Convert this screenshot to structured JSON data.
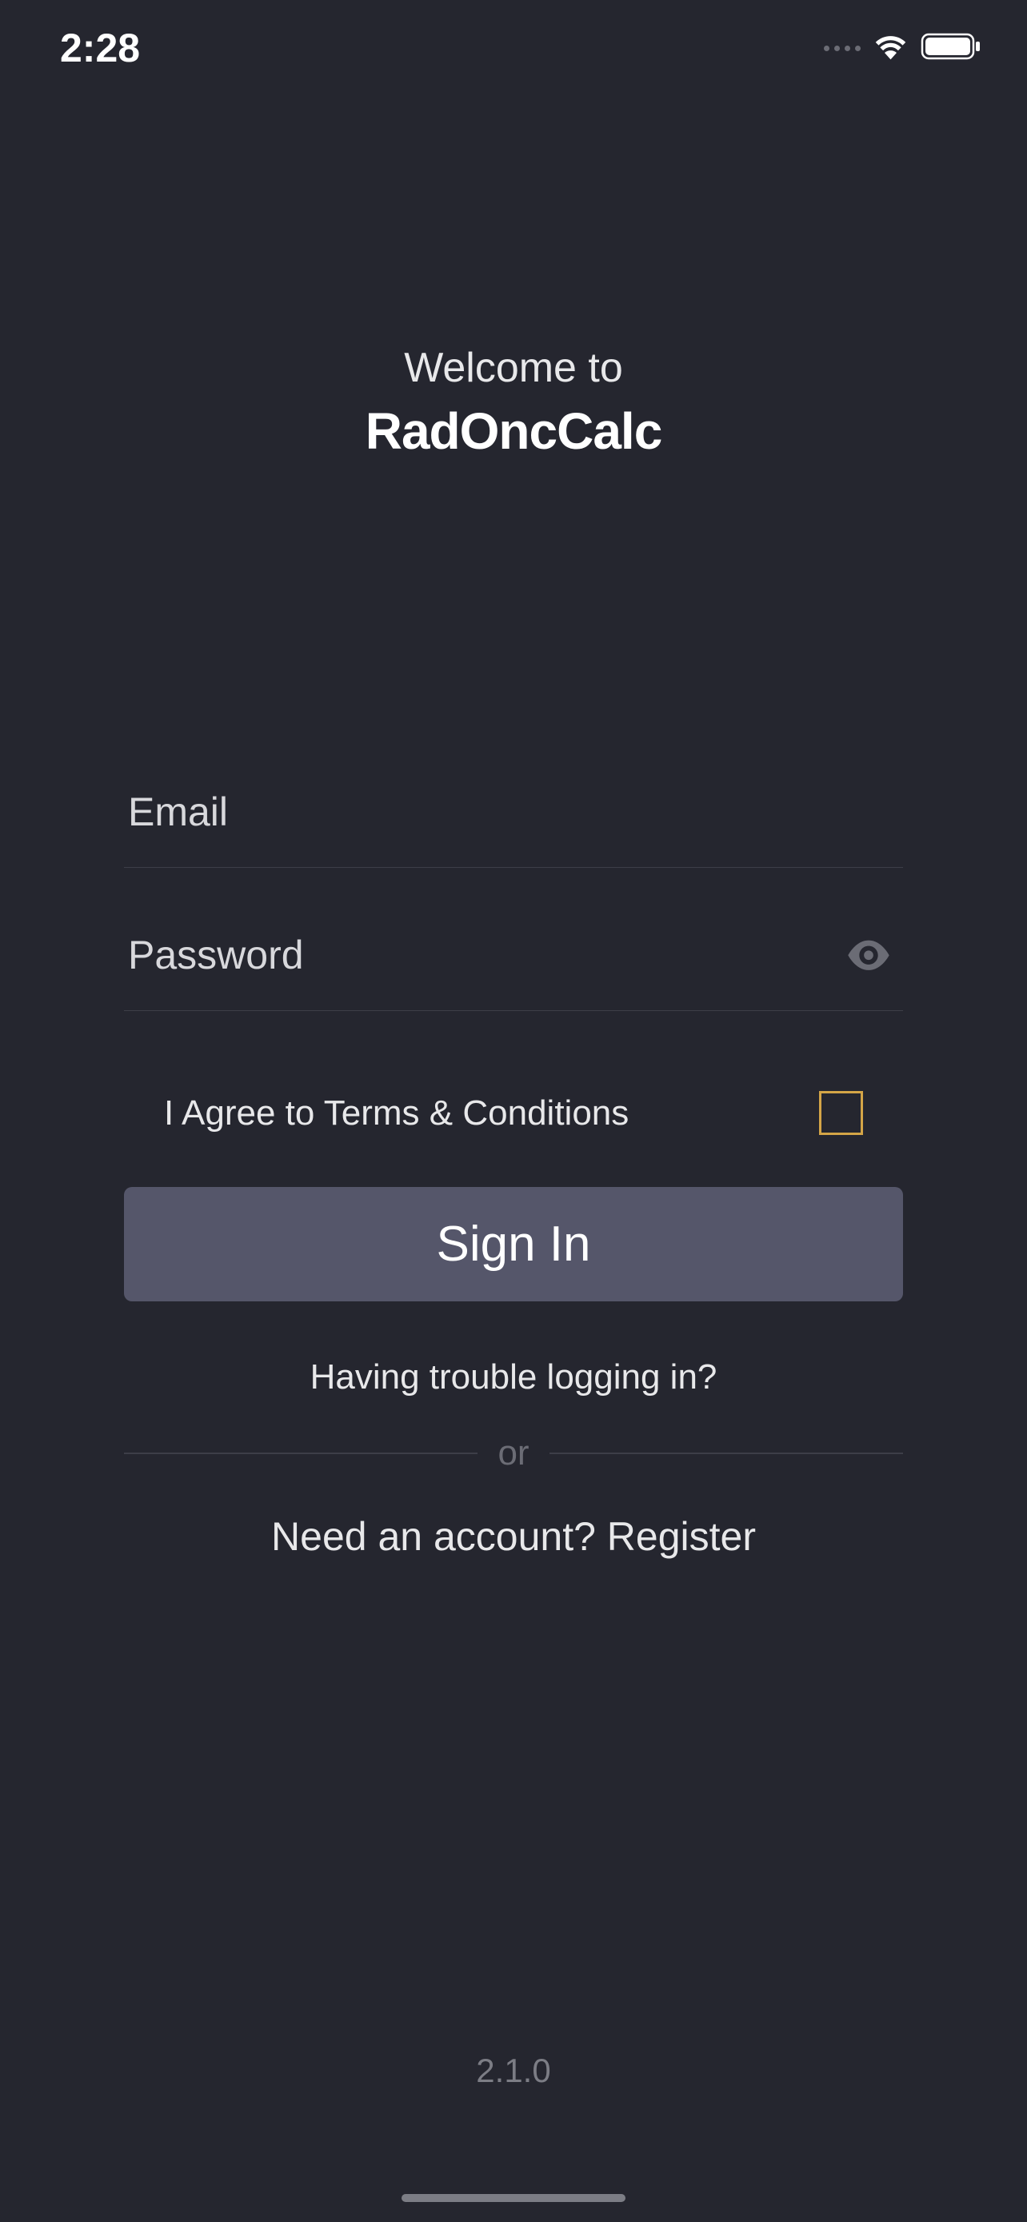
{
  "status": {
    "time": "2:28"
  },
  "header": {
    "welcome": "Welcome to",
    "app_name": "RadOncCalc"
  },
  "form": {
    "email_placeholder": "Email",
    "password_placeholder": "Password",
    "terms_label": "I Agree to Terms & Conditions",
    "signin_label": "Sign In",
    "trouble_label": "Having trouble logging in?",
    "divider_label": "or",
    "register_label": "Need an account? Register"
  },
  "footer": {
    "version": "2.1.0"
  }
}
